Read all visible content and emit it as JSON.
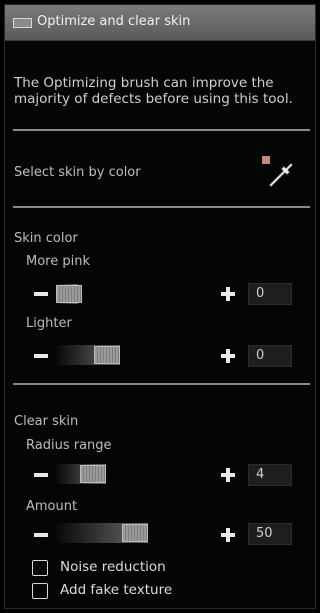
{
  "header": {
    "title": "Optimize and clear skin"
  },
  "description": "The Optimizing brush can improve the majority of defects before using this tool.",
  "select_skin": {
    "label": "Select skin by color",
    "swatch_color": "#c08a76",
    "picker_icon": "eyedropper-icon"
  },
  "skin_color": {
    "heading": "Skin color",
    "more_pink": {
      "label": "More pink",
      "value": "0",
      "level": 0.0
    },
    "lighter": {
      "label": "Lighter",
      "value": "0",
      "level": 0.5
    }
  },
  "clear_skin": {
    "heading": "Clear skin",
    "radius_range": {
      "label": "Radius range",
      "value": "4",
      "level": 0.25
    },
    "amount": {
      "label": "Amount",
      "value": "50",
      "level": 0.8
    }
  },
  "options": {
    "noise_reduction": {
      "label": "Noise reduction",
      "checked": false
    },
    "add_fake_texture": {
      "label": "Add fake texture",
      "checked": false
    }
  }
}
